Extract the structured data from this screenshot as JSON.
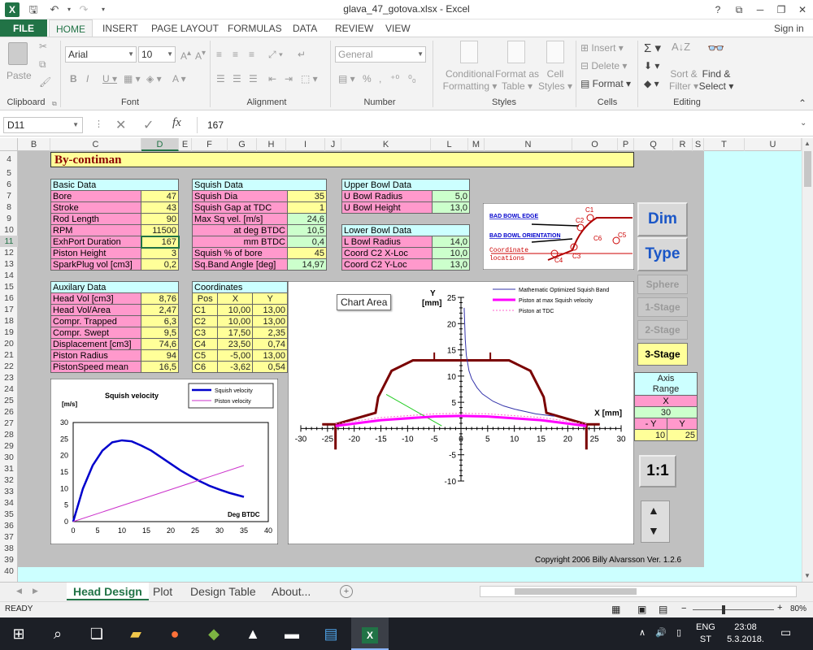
{
  "window": {
    "title": "glava_47_gotova.xlsx - Excel",
    "help": "?",
    "signin": "Sign in"
  },
  "ribbon": {
    "tabs": [
      "FILE",
      "HOME",
      "INSERT",
      "PAGE LAYOUT",
      "FORMULAS",
      "DATA",
      "REVIEW",
      "VIEW"
    ],
    "active_tab": "HOME",
    "paste": "Paste",
    "clipboard": "Clipboard",
    "font_name": "Arial",
    "font_size": "10",
    "font": "Font",
    "alignment": "Alignment",
    "number_format": "General",
    "number": "Number",
    "conditional": "Conditional",
    "formatting": "Formatting",
    "format_as": "Format as",
    "table": "Table",
    "cell": "Cell",
    "styles_lbl": "Styles",
    "styles": "Styles",
    "insert": "Insert",
    "delete": "Delete",
    "format": "Format",
    "cells": "Cells",
    "sort": "Sort &",
    "filter": "Filter",
    "find": "Find &",
    "select": "Select",
    "editing": "Editing"
  },
  "formula_bar": {
    "cell_ref": "D11",
    "value": "167"
  },
  "columns": [
    "B",
    "C",
    "D",
    "E",
    "F",
    "G",
    "H",
    "I",
    "J",
    "K",
    "L",
    "M",
    "N",
    "O",
    "P",
    "Q",
    "R",
    "S",
    "T",
    "U"
  ],
  "rows": [
    "4",
    "5",
    "6",
    "7",
    "8",
    "9",
    "10",
    "11",
    "12",
    "13",
    "14",
    "15",
    "16",
    "17",
    "18",
    "19",
    "20",
    "21",
    "22",
    "23",
    "24",
    "25",
    "26",
    "27",
    "28",
    "29",
    "30",
    "31",
    "32",
    "33",
    "34",
    "35",
    "36",
    "37",
    "38",
    "39",
    "40"
  ],
  "banner": "By-contiman",
  "basic": {
    "title": "Basic Data",
    "rows": [
      [
        "Bore",
        "47"
      ],
      [
        "Stroke",
        "43"
      ],
      [
        "Rod Length",
        "90"
      ],
      [
        "RPM",
        "11500"
      ],
      [
        "ExhPort Duration",
        "167"
      ],
      [
        "Piston Height",
        "3"
      ],
      [
        "SparkPlug vol [cm3]",
        "0,2"
      ]
    ]
  },
  "squish": {
    "title": "Squish Data",
    "rows": [
      [
        "Squish Dia",
        "35"
      ],
      [
        "Squish Gap at TDC",
        "1"
      ],
      [
        "Max Sq vel. [m/s]",
        "24,6"
      ],
      [
        "at deg BTDC",
        "10,5"
      ],
      [
        "mm BTDC",
        "0,4"
      ],
      [
        "Squish % of bore",
        "45"
      ],
      [
        "Sq.Band Angle [deg]",
        "14,97"
      ]
    ]
  },
  "upper": {
    "title": "Upper Bowl Data",
    "rows": [
      [
        "U Bowl Radius",
        "5,0"
      ],
      [
        "U Bowl Height",
        "13,0"
      ]
    ]
  },
  "lower": {
    "title": "Lower Bowl Data",
    "rows": [
      [
        "L Bowl Radius",
        "14,0"
      ],
      [
        "Coord C2 X-Loc",
        "10,0"
      ],
      [
        "Coord C2 Y-Loc",
        "13,0"
      ]
    ]
  },
  "aux": {
    "title": "Auxilary Data",
    "rows": [
      [
        "Head Vol [cm3]",
        "8,76"
      ],
      [
        "Head Vol/Area",
        "2,47"
      ],
      [
        "Compr. Trapped",
        "6,3"
      ],
      [
        "Compr. Swept",
        "9,5"
      ],
      [
        "Displacement [cm3]",
        "74,6"
      ],
      [
        "Piston Radius",
        "94"
      ],
      [
        "PistonSpeed mean",
        "16,5"
      ]
    ]
  },
  "coords": {
    "title": "Coordinates",
    "head": [
      "Pos",
      "X",
      "Y"
    ],
    "rows": [
      [
        "C1",
        "10,00",
        "13,00"
      ],
      [
        "C2",
        "10,00",
        "13,00"
      ],
      [
        "C3",
        "17,50",
        "2,35"
      ],
      [
        "C4",
        "23,50",
        "0,74"
      ],
      [
        "C5",
        "-5,00",
        "13,00"
      ],
      [
        "C6",
        "-3,62",
        "0,54"
      ]
    ]
  },
  "diagram": {
    "bad_edge": "BAD BOWL EDGE",
    "bad_orient": "BAD BOWL ORIENTATION",
    "coord1": "Coordinate",
    "coord2": "locations",
    "c1": "C1",
    "c2": "C2",
    "c3": "C3",
    "c4": "C4",
    "c5": "C5",
    "c6": "C6"
  },
  "buttons": {
    "dim": "Dim",
    "type": "Type",
    "sphere": "Sphere",
    "s1": "1-Stage",
    "s2": "2-Stage",
    "s3": "3-Stage",
    "ratio": "1:1"
  },
  "axis": {
    "title1": "Axis",
    "title2": "Range",
    "x": "X",
    "x_val": "30",
    "neg_y": "- Y",
    "y": "Y",
    "neg_y_val": "10",
    "y_val": "25"
  },
  "tooltip": "Chart Area",
  "copyright": "Copyright 2006 Billy Alvarsson   Ver. 1.2.6",
  "chart_data": [
    {
      "type": "line",
      "title": "Squish velocity",
      "ylabel": "[m/s]",
      "xlabel": "Deg BTDC",
      "xlim": [
        0,
        40
      ],
      "ylim": [
        0,
        30
      ],
      "xticks": [
        0,
        5,
        10,
        15,
        20,
        25,
        30,
        35,
        40
      ],
      "yticks": [
        0,
        5,
        10,
        15,
        20,
        25,
        30
      ],
      "series": [
        {
          "name": "Squish velocity",
          "color": "#0000cc",
          "x": [
            0,
            2,
            4,
            6,
            8,
            10,
            12,
            14,
            16,
            18,
            20,
            22,
            24,
            26,
            28,
            30,
            32,
            35
          ],
          "y": [
            0,
            10,
            17,
            21.5,
            24,
            24.6,
            24.3,
            23,
            21.5,
            19.5,
            17.5,
            15.5,
            13.8,
            12.2,
            10.8,
            9.7,
            8.7,
            7.5
          ]
        },
        {
          "name": "Piston velocity",
          "color": "#cc33cc",
          "x": [
            0,
            35
          ],
          "y": [
            0,
            17
          ]
        }
      ]
    },
    {
      "type": "line",
      "xlabel": "X  [mm]",
      "ylabel_1": "Y",
      "ylabel_2": "[mm]",
      "xlim": [
        -30,
        30
      ],
      "ylim": [
        -10,
        25
      ],
      "xticks": [
        -30,
        -25,
        -20,
        -15,
        -10,
        -5,
        0,
        5,
        10,
        15,
        20,
        25,
        30
      ],
      "yticks": [
        -10,
        -5,
        0,
        5,
        10,
        15,
        20,
        25
      ],
      "legend": [
        "Mathematic Optimized Squish Band",
        "Piston at max Squish velocity",
        "Piston at TDC"
      ],
      "series": [
        {
          "name": "Mathematic Optimized Squish Band",
          "color": "#3333aa",
          "x": [
            0.6,
            0.8,
            1,
            1.5,
            2,
            3,
            4,
            6,
            8,
            10,
            14,
            17.5
          ],
          "y": [
            23,
            17,
            14,
            11,
            9.5,
            7.8,
            6.6,
            5.2,
            4.3,
            3.7,
            2.8,
            2.35
          ]
        },
        {
          "name": "Piston at max Squish velocity",
          "color": "#ff00ff",
          "x": [
            -23.5,
            -15,
            -5,
            0,
            5,
            15,
            23.5
          ],
          "y": [
            0.5,
            1.6,
            2.3,
            2.4,
            2.3,
            1.6,
            0.5
          ]
        },
        {
          "name": "Piston at TDC",
          "color": "#ff66cc",
          "x": [
            -23.5,
            -15,
            -5,
            0,
            5,
            15,
            23.5
          ],
          "y": [
            0.9,
            2.1,
            2.8,
            2.9,
            2.8,
            2.1,
            0.9
          ]
        }
      ]
    }
  ]
}
